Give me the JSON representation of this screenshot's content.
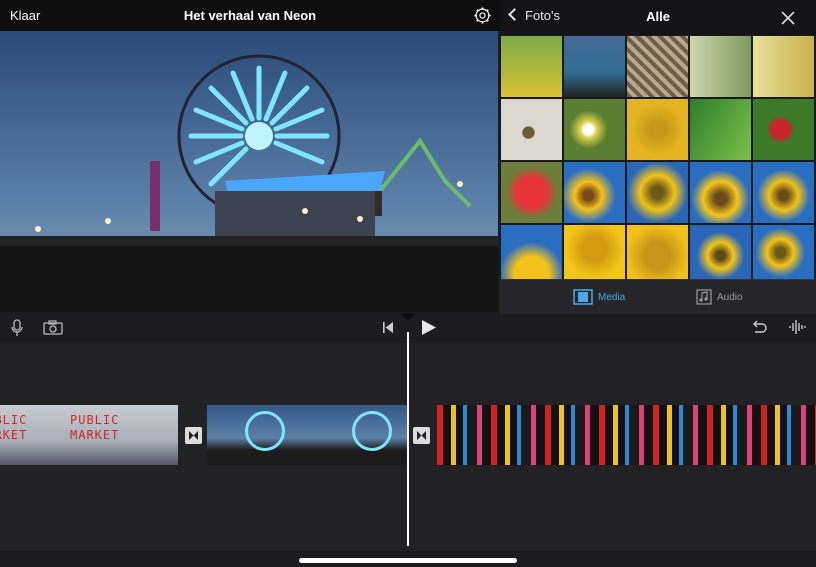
{
  "topbar": {
    "done_label": "Klaar",
    "title": "Het verhaal van Neon",
    "settings_icon": "gear-icon"
  },
  "browser": {
    "back_label": "Foto's",
    "title": "Alle",
    "close_icon": "close-icon",
    "thumbnails": [
      "flowers-field",
      "ferris-wheel-pier",
      "sunflower-seeds",
      "woman-outdoors",
      "yellow-fabric",
      "seed-closeup",
      "daisies",
      "sunflower-center",
      "green-leaf",
      "strawberry-plant",
      "strawberry",
      "sunflowers-sky",
      "sunflower-closeup",
      "sunflower-blue-sky",
      "sunflower-right",
      "sunflower-bloom",
      "sunflower-petals",
      "sunflower-head",
      "sunflower-small",
      "sunflower-pair"
    ],
    "tabs": [
      {
        "label": "Media",
        "icon": "film-icon",
        "active": true
      },
      {
        "label": "Audio",
        "icon": "music-icon",
        "active": false
      }
    ]
  },
  "timeline": {
    "clips": [
      {
        "name": "public-market",
        "sign_line1": "PUBLIC",
        "sign_line2": "MARKET"
      },
      {
        "name": "ferris-wheel-pier"
      },
      {
        "name": "neon-street"
      }
    ]
  },
  "colors": {
    "accent": "#4aa8e8",
    "background": "#1c1c1e"
  }
}
